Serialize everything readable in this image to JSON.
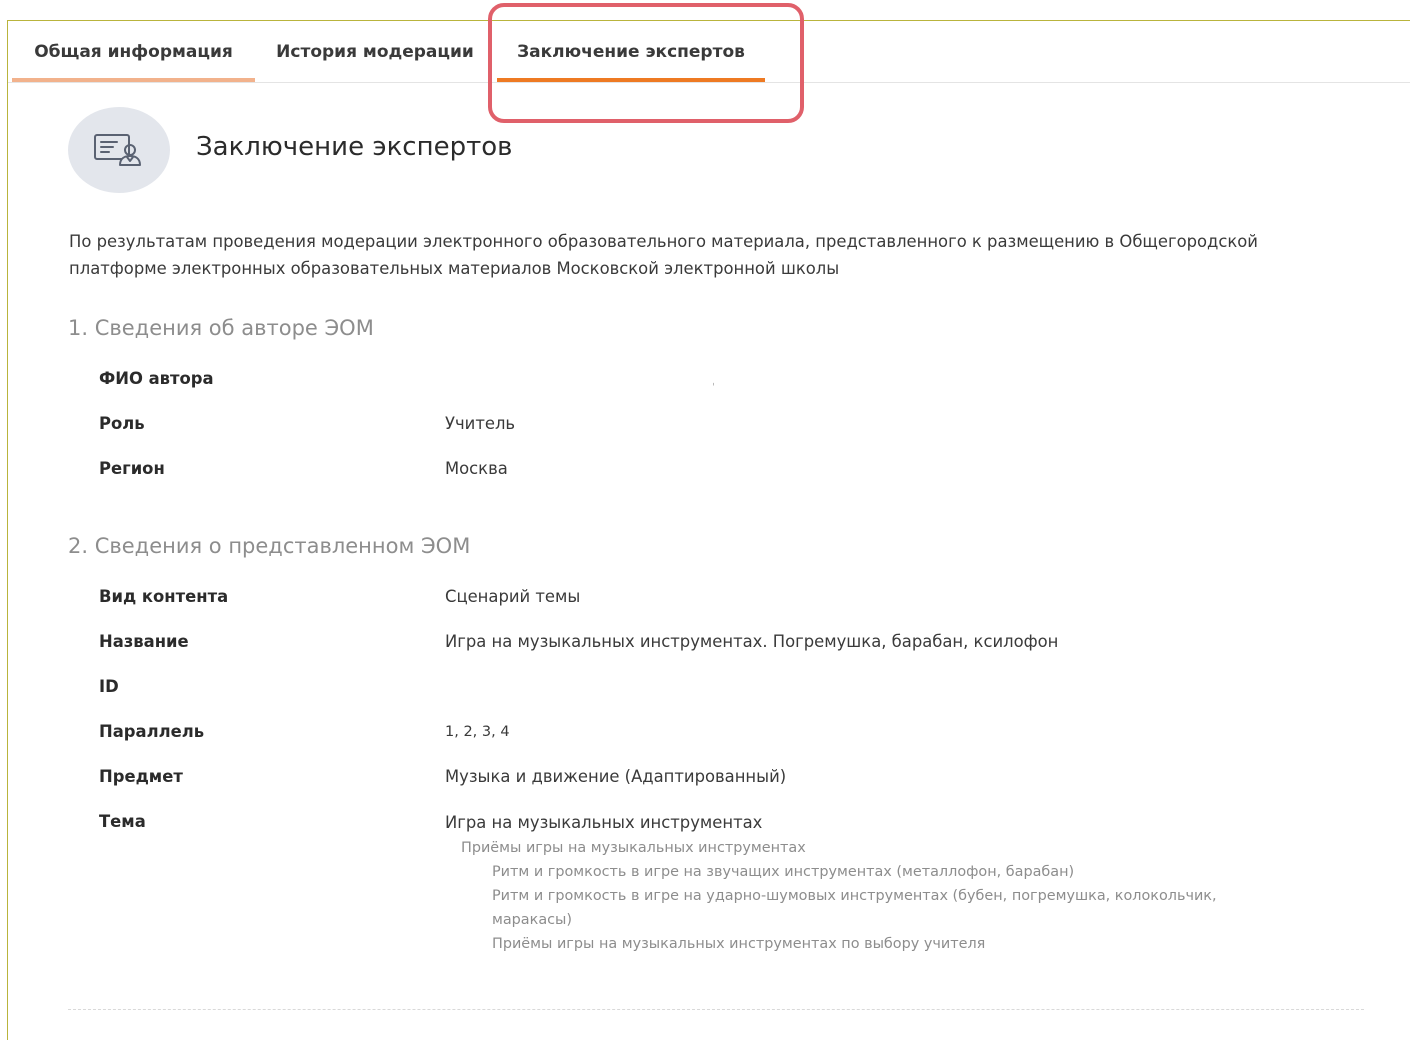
{
  "tabs": [
    {
      "label": "Общая информация",
      "state": "visited"
    },
    {
      "label": "История модерации",
      "state": "default"
    },
    {
      "label": "Заключение экспертов",
      "state": "active"
    }
  ],
  "header": {
    "title": "Заключение экспертов",
    "icon": "certificate-user-icon"
  },
  "intro": "По результатам проведения модерации электронного образовательного материала, представленного к размещению в Общегородской платформе электронных образовательных материалов Московской электронной школы",
  "section1": {
    "title": "1. Сведения об авторе ЭОМ",
    "rows": [
      {
        "label": "ФИО автора",
        "value": ""
      },
      {
        "label": "Роль",
        "value": "Учитель"
      },
      {
        "label": "Регион",
        "value": "Москва"
      }
    ]
  },
  "section2": {
    "title": "2. Сведения о представленном ЭОМ",
    "rows": [
      {
        "label": "Вид контента",
        "value": "Сценарий темы"
      },
      {
        "label": "Название",
        "value": "Игра на музыкальных инструментах. Погремушка, барабан, ксилофон"
      },
      {
        "label": "ID",
        "value": ""
      },
      {
        "label": "Параллель",
        "value": "1, 2, 3, 4"
      },
      {
        "label": "Предмет",
        "value": "Музыка и движение (Адаптированный)"
      },
      {
        "label": "Тема",
        "value": ""
      }
    ],
    "topic_tree": {
      "root": "Игра на музыкальных инструментах",
      "level1": "Приёмы игры на музыкальных инструментах",
      "level2": [
        "Ритм и громкость в игре на звучащих инструментах (металлофон, барабан)",
        "Ритм и громкость в игре на ударно-шумовых инструментах (бубен, погремушка, колокольчик, маракасы)",
        "Приёмы игры на музыкальных инструментах по выбору учителя"
      ]
    }
  },
  "colors": {
    "accent": "#ee7a23",
    "accent_light": "#f2b28c",
    "highlight_box": "#e0606a",
    "frame": "#b9b43c"
  }
}
